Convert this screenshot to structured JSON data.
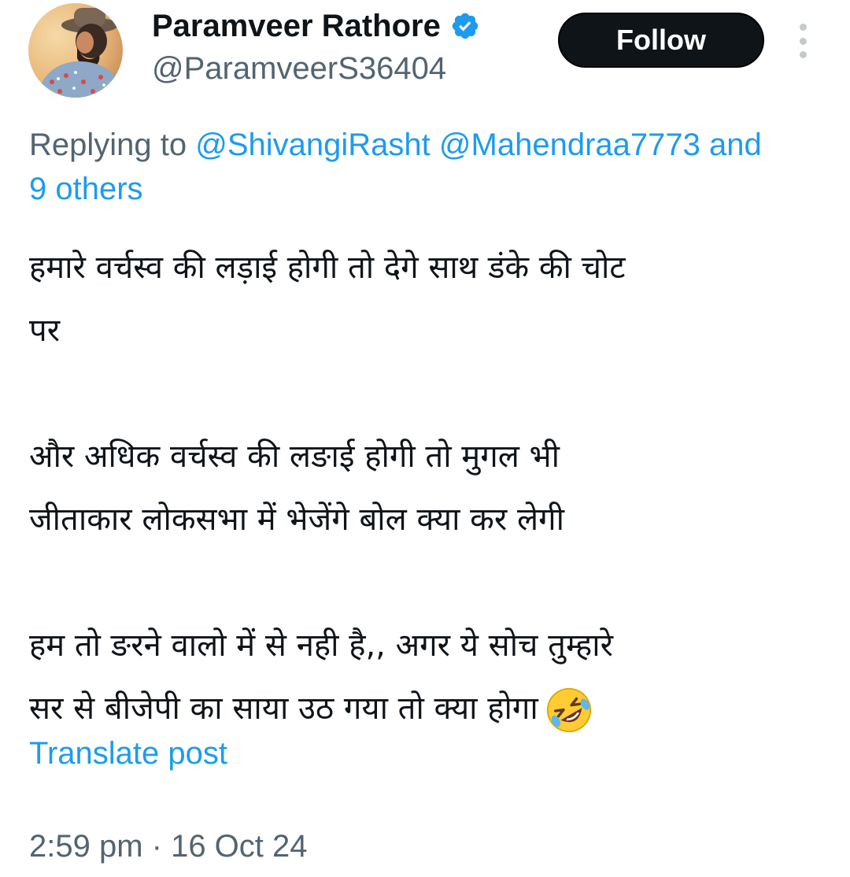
{
  "author": {
    "display_name": "Paramveer Rathore",
    "handle": "@ParamveerS36404",
    "verified_icon": "verified-badge-icon",
    "verified_color": "#1d9bf0"
  },
  "actions": {
    "follow_label": "Follow",
    "more_icon": "more-vertical-icon"
  },
  "reply": {
    "prefix": "Replying to ",
    "mentions": [
      "@ShivangiRasht",
      "@Mahendraa7773"
    ],
    "joiner": "and",
    "others": "9 others"
  },
  "post": {
    "paragraphs": [
      [
        "हमारे वर्चस्व की लड़ाई होगी तो देगे साथ डंके की चोट",
        "पर"
      ],
      [
        "और अधिक वर्चस्व की लङाई होगी तो मुगल भी",
        "जीताकार लोकसभा में भेजेंगे बोल क्या कर लेगी"
      ],
      [
        "हम तो ङरने वालो में से नही है,, अगर ये सोच तुम्हारे",
        "सर से बीजेपी का साया उठ गया तो क्या होगा"
      ]
    ],
    "emoji_icon": "rolling-on-floor-laughing-emoji-icon",
    "translate_label": "Translate post",
    "timestamp": "2:59 pm · 16 Oct 24"
  },
  "colors": {
    "link": "#1d9bf0",
    "secondary_text": "#536471",
    "primary_text": "#0f1419",
    "button_bg": "#0f1419"
  }
}
